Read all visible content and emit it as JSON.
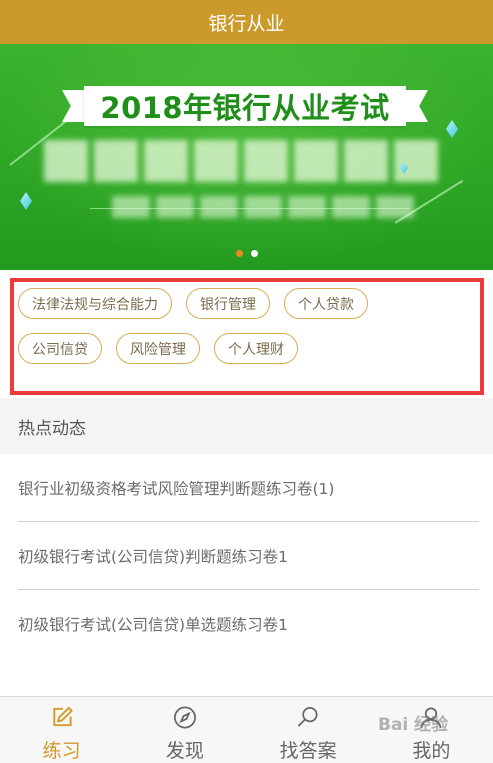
{
  "header": {
    "title": "银行从业"
  },
  "banner": {
    "title": "2018年银行从业考试",
    "slide_count": 2,
    "active_slide": 1
  },
  "tags": {
    "row1": [
      "法律法规与综合能力",
      "银行管理",
      "个人贷款"
    ],
    "row2": [
      "公司信贷",
      "风险管理",
      "个人理财"
    ]
  },
  "hot": {
    "title": "热点动态",
    "items": [
      "银行业初级资格考试风险管理判断题练习卷(1)",
      "初级银行考试(公司信贷)判断题练习卷1",
      "初级银行考试(公司信贷)单选题练习卷1"
    ]
  },
  "nav": {
    "items": [
      {
        "label": "练习",
        "icon": "edit-icon"
      },
      {
        "label": "发现",
        "icon": "compass-icon"
      },
      {
        "label": "找答案",
        "icon": "search-icon"
      },
      {
        "label": "我的",
        "icon": "user-icon"
      }
    ],
    "active": "练习"
  },
  "colors": {
    "header_bg": "#cc9a2a",
    "banner_green": "#2ea526",
    "highlight_border": "#ee3a3a",
    "tag_border": "#d9ad55",
    "nav_active": "#d39a2a",
    "dot_active": "#f08a1c"
  },
  "watermark": "Bai 经验"
}
